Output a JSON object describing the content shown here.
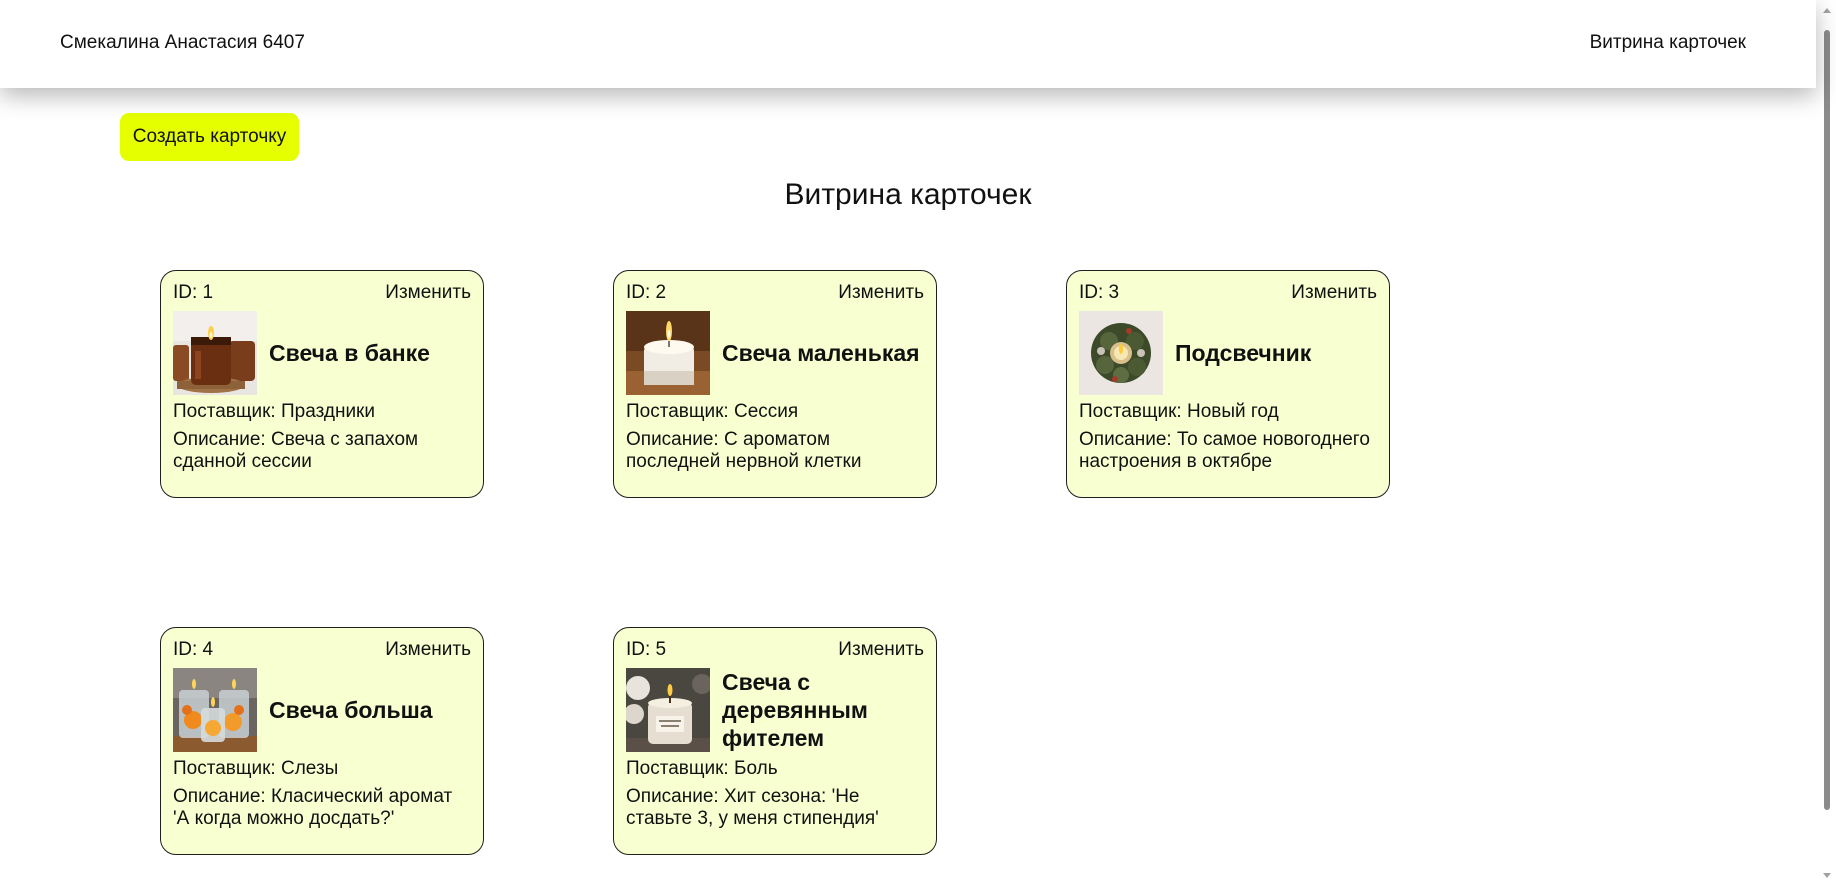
{
  "header": {
    "author": "Смекалина Анастасия 6407",
    "nav_link": "Витрина карточек"
  },
  "toolbar": {
    "create_label": "Создать карточку"
  },
  "main": {
    "title": "Витрина карточек"
  },
  "cards": [
    {
      "id_label": "ID: 1",
      "edit_label": "Изменить",
      "title": "Свеча в банке",
      "supplier": "Поставщик: Праздники",
      "description": "Описание: Свеча с запахом сданной сессии",
      "image_icon": "amber-jar-candle-photo"
    },
    {
      "id_label": "ID: 2",
      "edit_label": "Изменить",
      "title": "Свеча маленькая",
      "supplier": "Поставщик: Сессия",
      "description": "Описание: С ароматом последней нервной клетки",
      "image_icon": "small-white-candle-photo"
    },
    {
      "id_label": "ID: 3",
      "edit_label": "Изменить",
      "title": "Подсвечник",
      "supplier": "Поставщик: Новый год",
      "description": "Описание: То самое новогоднего настроения в октябре",
      "image_icon": "wreath-candle-holder-photo"
    },
    {
      "id_label": "ID: 4",
      "edit_label": "Изменить",
      "title": "Свеча больша",
      "supplier": "Поставщик: Слезы",
      "description": "Описание: Класический аромат 'А когда можно досдать?'",
      "image_icon": "orange-glass-candles-photo"
    },
    {
      "id_label": "ID: 5",
      "edit_label": "Изменить",
      "title": "Свеча с деревянным фителем",
      "supplier": "Поставщик: Боль",
      "description": "Описание: Хит сезона: 'Не ставьте 3, у меня стипендия'",
      "image_icon": "wooden-wick-candle-photo"
    }
  ],
  "colors": {
    "create_button": "#e5ff00",
    "card_background": "#f8ffd0",
    "card_border": "#1f1f1f"
  }
}
